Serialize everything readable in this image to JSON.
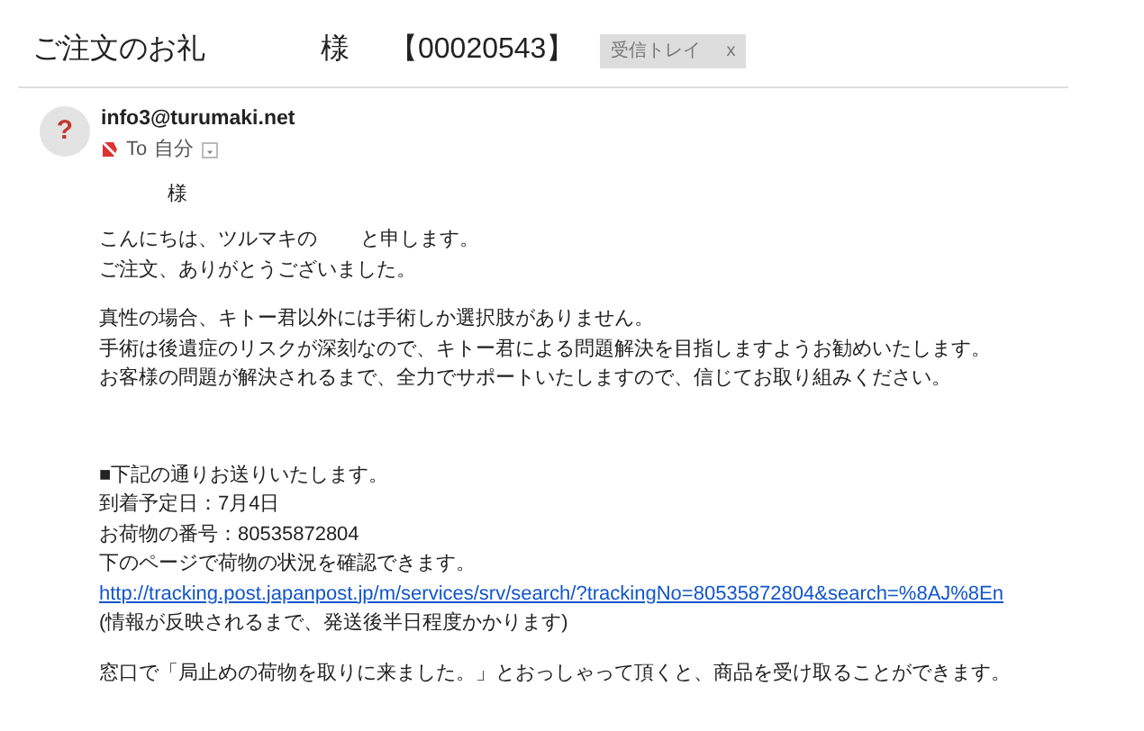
{
  "subject": {
    "title": "ご注文のお礼",
    "honorific": "様",
    "order_no": "【00020543】",
    "label": {
      "text": "受信トレイ",
      "close": "x"
    }
  },
  "message": {
    "avatar": "?",
    "sender": "info3@turumaki.net",
    "to_prefix": "To",
    "to": "自分",
    "important": true
  },
  "greeting": "様",
  "blocks": [
    [
      {
        "kind": "split",
        "parts": [
          "こんにちは、ツルマキの",
          "と申します。"
        ]
      },
      {
        "kind": "text",
        "text": "ご注文、ありがとうございました。"
      }
    ],
    [
      {
        "kind": "text",
        "text": "真性の場合、キトー君以外には手術しか選択肢がありません。"
      },
      {
        "kind": "text",
        "text": "手術は後遺症のリスクが深刻なので、キトー君による問題解決を目指しますようお勧めいたします。"
      },
      {
        "kind": "text",
        "text": "お客様の問題が解決されるまで、全力でサポートいたしますので、信じてお取り組みください。"
      }
    ],
    [
      {
        "kind": "text",
        "text": "■下記の通りお送りいたします。"
      },
      {
        "kind": "text",
        "text": "到着予定日：7月4日"
      },
      {
        "kind": "text",
        "text": "お荷物の番号：80535872804"
      },
      {
        "kind": "text",
        "text": "下のページで荷物の状況を確認できます。"
      },
      {
        "kind": "link",
        "text": "http://tracking.post.japanpost.jp/m/services/srv/search/?trackingNo=80535872804&search=%8AJ%8En"
      },
      {
        "kind": "text",
        "text": "(情報が反映されるまで、発送後半日程度かかります)"
      }
    ],
    [
      {
        "kind": "text",
        "text": "窓口で「局止めの荷物を取りに来ました。」とおっしゃって頂くと、商品を受け取ることができます。"
      }
    ]
  ]
}
